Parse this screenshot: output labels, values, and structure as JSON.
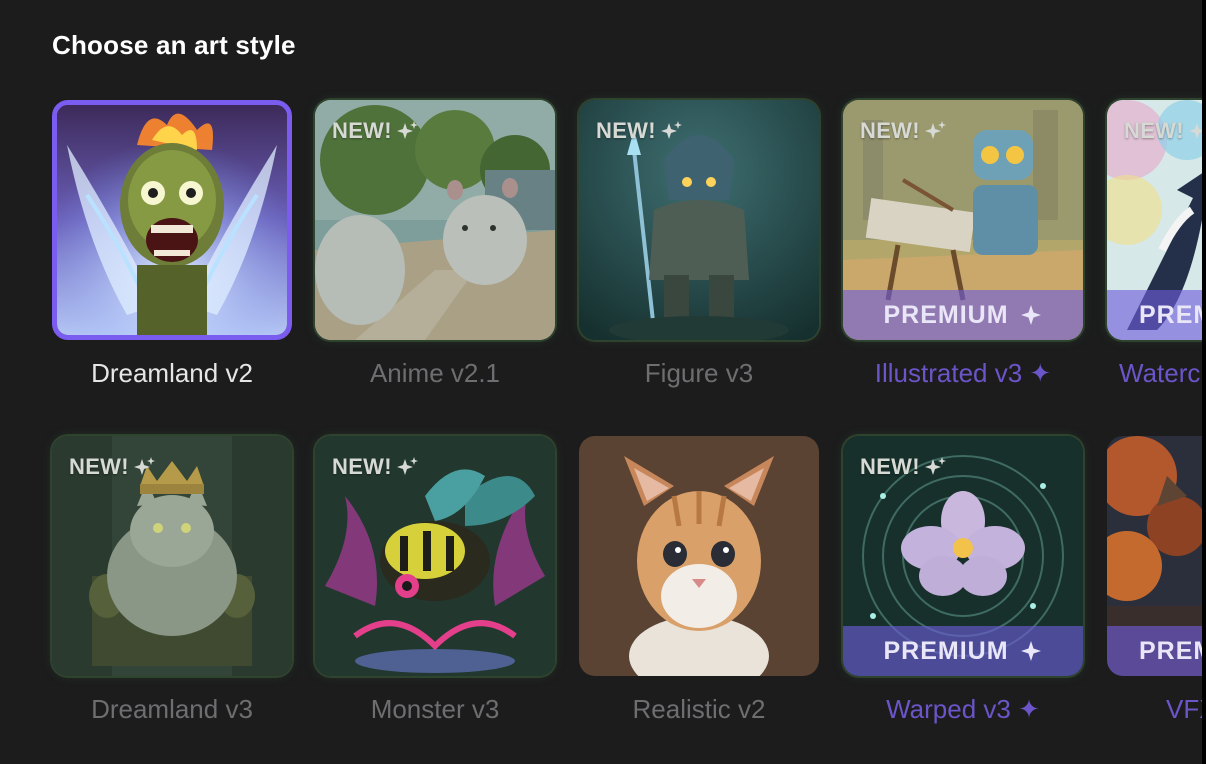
{
  "header": {
    "title": "Choose an art style"
  },
  "badges": {
    "new": "NEW!",
    "premium": "PREMIUM"
  },
  "colors": {
    "background": "#1c1c1d",
    "accent": "#7b5cf0",
    "premium_label": "#6b55c8",
    "muted_label": "#6e6e70",
    "selected_label": "#e6e6e6"
  },
  "styles": [
    {
      "label": "Dreamland v2",
      "selected": true,
      "new": false,
      "premium": false,
      "icon": "screaming-alien-art"
    },
    {
      "label": "Anime v2.1",
      "selected": false,
      "new": true,
      "premium": false,
      "icon": "anime-hamsters-art"
    },
    {
      "label": "Figure v3",
      "selected": false,
      "new": true,
      "premium": false,
      "icon": "armored-figure-art"
    },
    {
      "label": "Illustrated v3 ✦",
      "selected": false,
      "new": true,
      "premium": true,
      "icon": "painter-robot-art"
    },
    {
      "label": "Waterc",
      "selected": false,
      "new": true,
      "premium": true,
      "icon": "watercolor-orca-art"
    },
    {
      "label": "Dreamland v3",
      "selected": false,
      "new": true,
      "premium": false,
      "icon": "king-cat-art"
    },
    {
      "label": "Monster v3",
      "selected": false,
      "new": true,
      "premium": false,
      "icon": "monster-bee-art"
    },
    {
      "label": "Realistic v2",
      "selected": false,
      "new": false,
      "premium": false,
      "icon": "kitten-art"
    },
    {
      "label": "Warped v3 ✦",
      "selected": false,
      "new": true,
      "premium": true,
      "icon": "warped-flower-art"
    },
    {
      "label": "VFX",
      "selected": false,
      "new": false,
      "premium": true,
      "icon": "vfx-forest-art"
    }
  ]
}
